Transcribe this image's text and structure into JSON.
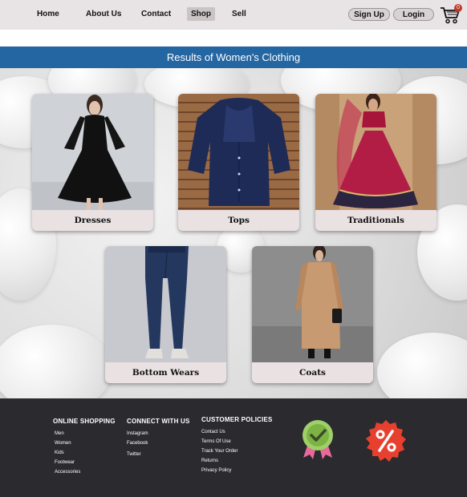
{
  "nav": {
    "links": [
      "Home",
      "About Us",
      "Contact",
      "Shop",
      "Sell"
    ],
    "signup": "Sign Up",
    "login": "Login",
    "cart_count": "0"
  },
  "results_title": "Results of Women's Clothing",
  "categories": [
    {
      "label": "Dresses",
      "icon": "black-dress-photo"
    },
    {
      "label": "Tops",
      "icon": "navy-top-photo"
    },
    {
      "label": "Traditionals",
      "icon": "lehenga-photo"
    },
    {
      "label": "Bottom Wears",
      "icon": "jeans-photo"
    },
    {
      "label": "Coats",
      "icon": "trench-coat-photo"
    }
  ],
  "footer": {
    "online_shopping": {
      "title": "ONLINE SHOPPING",
      "items": [
        "Men",
        "Women",
        "Kids",
        "Footwear",
        "Accessories"
      ]
    },
    "connect": {
      "title": "CONNECT WITH US",
      "items": [
        "Instagram",
        "Facebook",
        "Twitter"
      ]
    },
    "policies": {
      "title": "CUSTOMER POLICIES",
      "items": [
        "Contact Us",
        "Terms Of Use",
        "Track Your Order",
        "Returns",
        "Privacy Policy"
      ]
    },
    "badges": [
      "quality-check-badge-icon",
      "discount-percent-badge-icon"
    ]
  },
  "colors": {
    "accent": "#2466a1",
    "nav_bg": "#e8e3e4",
    "footer_bg": "#2b2a2f",
    "discount": "#e8402f",
    "badge_green": "#7cb342"
  }
}
